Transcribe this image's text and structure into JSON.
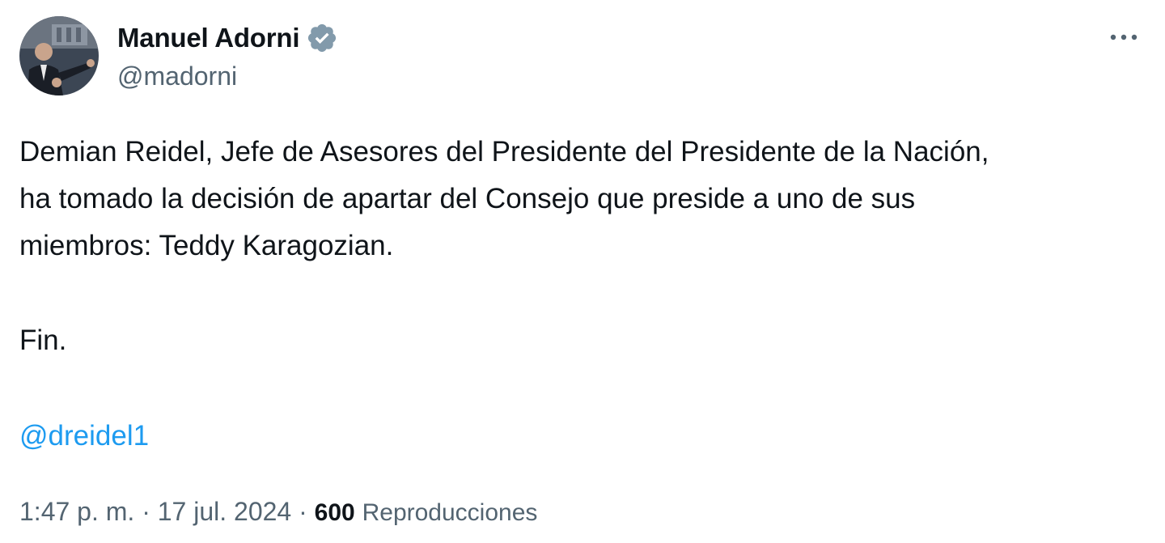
{
  "author": {
    "display_name": "Manuel Adorni",
    "handle": "@madorni",
    "verified_icon": "verified-badge-icon",
    "verified_color": "#829aab"
  },
  "more_menu": {
    "icon": "more-horizontal-icon",
    "glyph": "···"
  },
  "tweet": {
    "lines": [
      "Demian Reidel, Jefe de Asesores del Presidente del Presidente de la Nación,",
      "ha tomado la decisión de apartar del Consejo que preside a uno de sus",
      "miembros: Teddy Karagozian.",
      "Fin."
    ],
    "mention": "@dreidel1",
    "mention_color": "#1d9bf0"
  },
  "meta": {
    "time": "1:47 p. m.",
    "separator": "·",
    "date": "17 jul. 2024",
    "views_count": "600",
    "views_label": "Reproducciones"
  }
}
